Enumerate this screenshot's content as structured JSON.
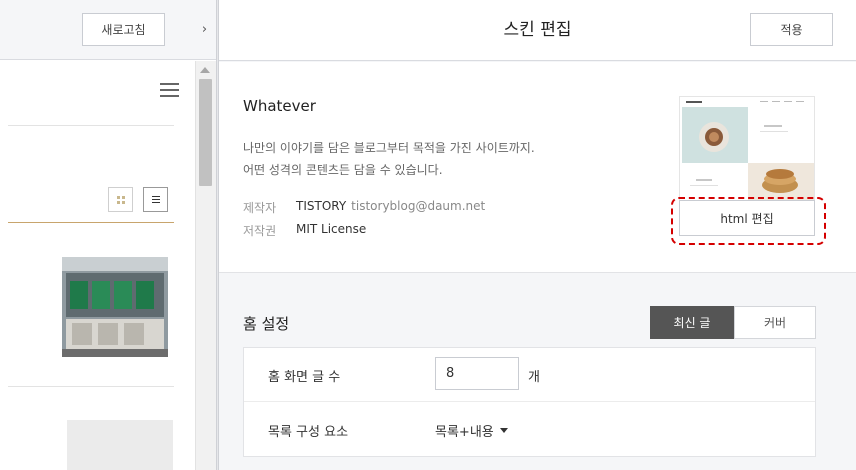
{
  "preview": {
    "refresh_label": "새로고침",
    "toggle_glyph": "›"
  },
  "editor": {
    "title": "스킨 편집",
    "apply_label": "적용"
  },
  "skin": {
    "name": "Whatever",
    "description_line1": "나만의 이야기를 담은 블로그부터 목적을 가진 사이트까지.",
    "description_line2": "어떤 성격의 콘텐츠든 담을 수 있습니다.",
    "author_label": "제작자",
    "author_name": "TISTORY",
    "author_email": "tistoryblog@daum.net",
    "license_label": "저작권",
    "license_value": "MIT License",
    "html_edit_label": "html 편집",
    "highlight_color": "#d40000"
  },
  "home_settings": {
    "title": "홈 설정",
    "tabs": [
      {
        "label": "최신 글",
        "active": true
      },
      {
        "label": "커버",
        "active": false
      }
    ],
    "post_count_label": "홈 화면 글 수",
    "post_count_value": "8",
    "post_count_unit": "개",
    "list_components_label": "목록 구성 요소",
    "list_components_value": "목록+내용"
  }
}
